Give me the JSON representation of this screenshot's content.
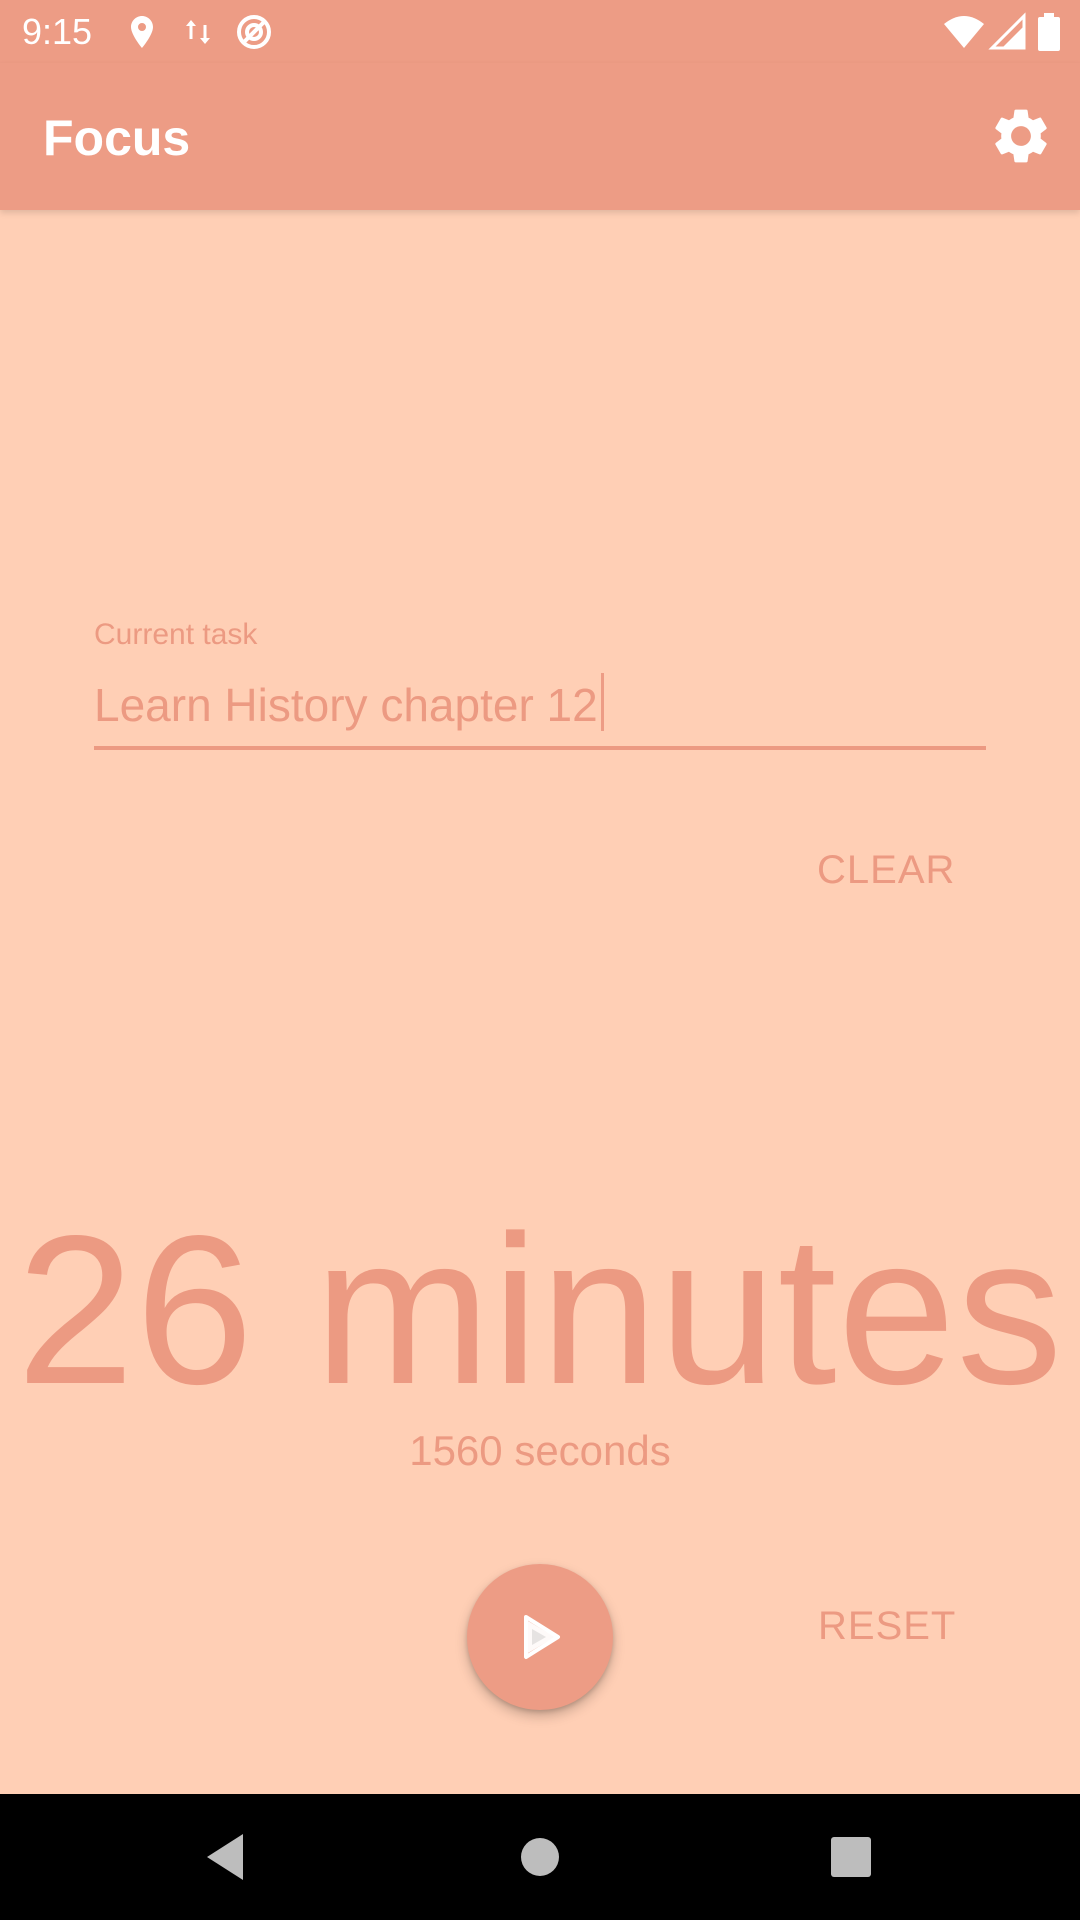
{
  "status_bar": {
    "time": "9:15",
    "left_icons": [
      "location-icon",
      "data-transfer-icon",
      "do-not-disturb-icon"
    ],
    "right_icons": [
      "wifi-icon",
      "cell-signal-icon",
      "battery-icon"
    ]
  },
  "app_bar": {
    "title": "Focus",
    "settings_icon": "gear-icon"
  },
  "task": {
    "label": "Current task",
    "value": "Learn History chapter 12",
    "clear_label": "CLEAR"
  },
  "timer": {
    "minutes_text": "26 minutes",
    "seconds_text": "1560 seconds"
  },
  "controls": {
    "play_icon": "play-icon",
    "reset_label": "RESET"
  },
  "nav_bar": {
    "icons": [
      "back-icon",
      "home-icon",
      "recents-icon"
    ]
  },
  "colors": {
    "accent": "#ED9C85",
    "background": "#FFCFB5",
    "text": "#EC9A82",
    "nav": "#000000"
  }
}
